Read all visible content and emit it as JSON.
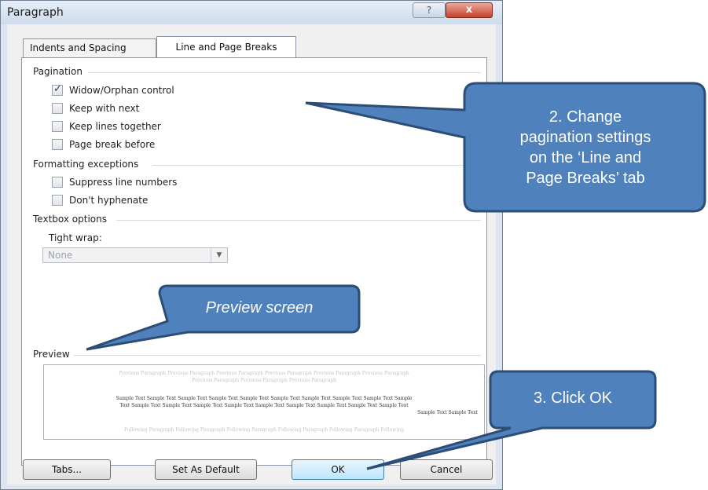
{
  "window": {
    "title": "Paragraph",
    "help_label": "?",
    "close_label": "x"
  },
  "tabs": [
    {
      "label": "Indents and Spacing"
    },
    {
      "label": "Line and Page Breaks"
    }
  ],
  "pagination": {
    "heading": "Pagination",
    "items": [
      {
        "label": "Widow/Orphan control",
        "checked": true
      },
      {
        "label": "Keep with next",
        "checked": false
      },
      {
        "label": "Keep lines together",
        "checked": false
      },
      {
        "label": "Page break before",
        "checked": false
      }
    ]
  },
  "formatting": {
    "heading": "Formatting exceptions",
    "items": [
      {
        "label": "Suppress line numbers",
        "checked": false
      },
      {
        "label": "Don't hyphenate",
        "checked": false
      }
    ]
  },
  "textbox": {
    "heading": "Textbox options",
    "tight_wrap_label": "Tight wrap:",
    "tight_wrap_value": "None"
  },
  "preview": {
    "heading": "Preview",
    "grey_lines": [
      "Previous Paragraph Previous Paragraph Previous Paragraph Previous Paragraph Previous Paragraph Previous Paragraph",
      "Previous Paragraph Previous Paragraph Previous Paragraph"
    ],
    "sample_lines": [
      "Sample Text Sample Text Sample Text Sample Text Sample Text Sample Text Sample Text Sample Text Sample Text Sample",
      "Text Sample Text Sample Text Sample Text Sample Text Sample Text Sample Text Sample Text Sample Text Sample Text",
      "Sample Text Sample Text"
    ],
    "following_line": "Following Paragraph Following Paragraph Following Paragraph Following Paragraph Following Paragraph Following"
  },
  "buttons": {
    "tabs": "Tabs...",
    "set_default": "Set As Default",
    "ok": "OK",
    "cancel": "Cancel"
  },
  "callouts": {
    "pagination": [
      "2. Change",
      "pagination settings",
      "on the ‘Line and",
      "Page Breaks’ tab"
    ],
    "preview": "Preview screen",
    "ok": "3. Click OK"
  },
  "colors": {
    "callout_fill": "#4f81bd",
    "callout_stroke": "#2c4d75",
    "close_button": "#c8412c"
  }
}
